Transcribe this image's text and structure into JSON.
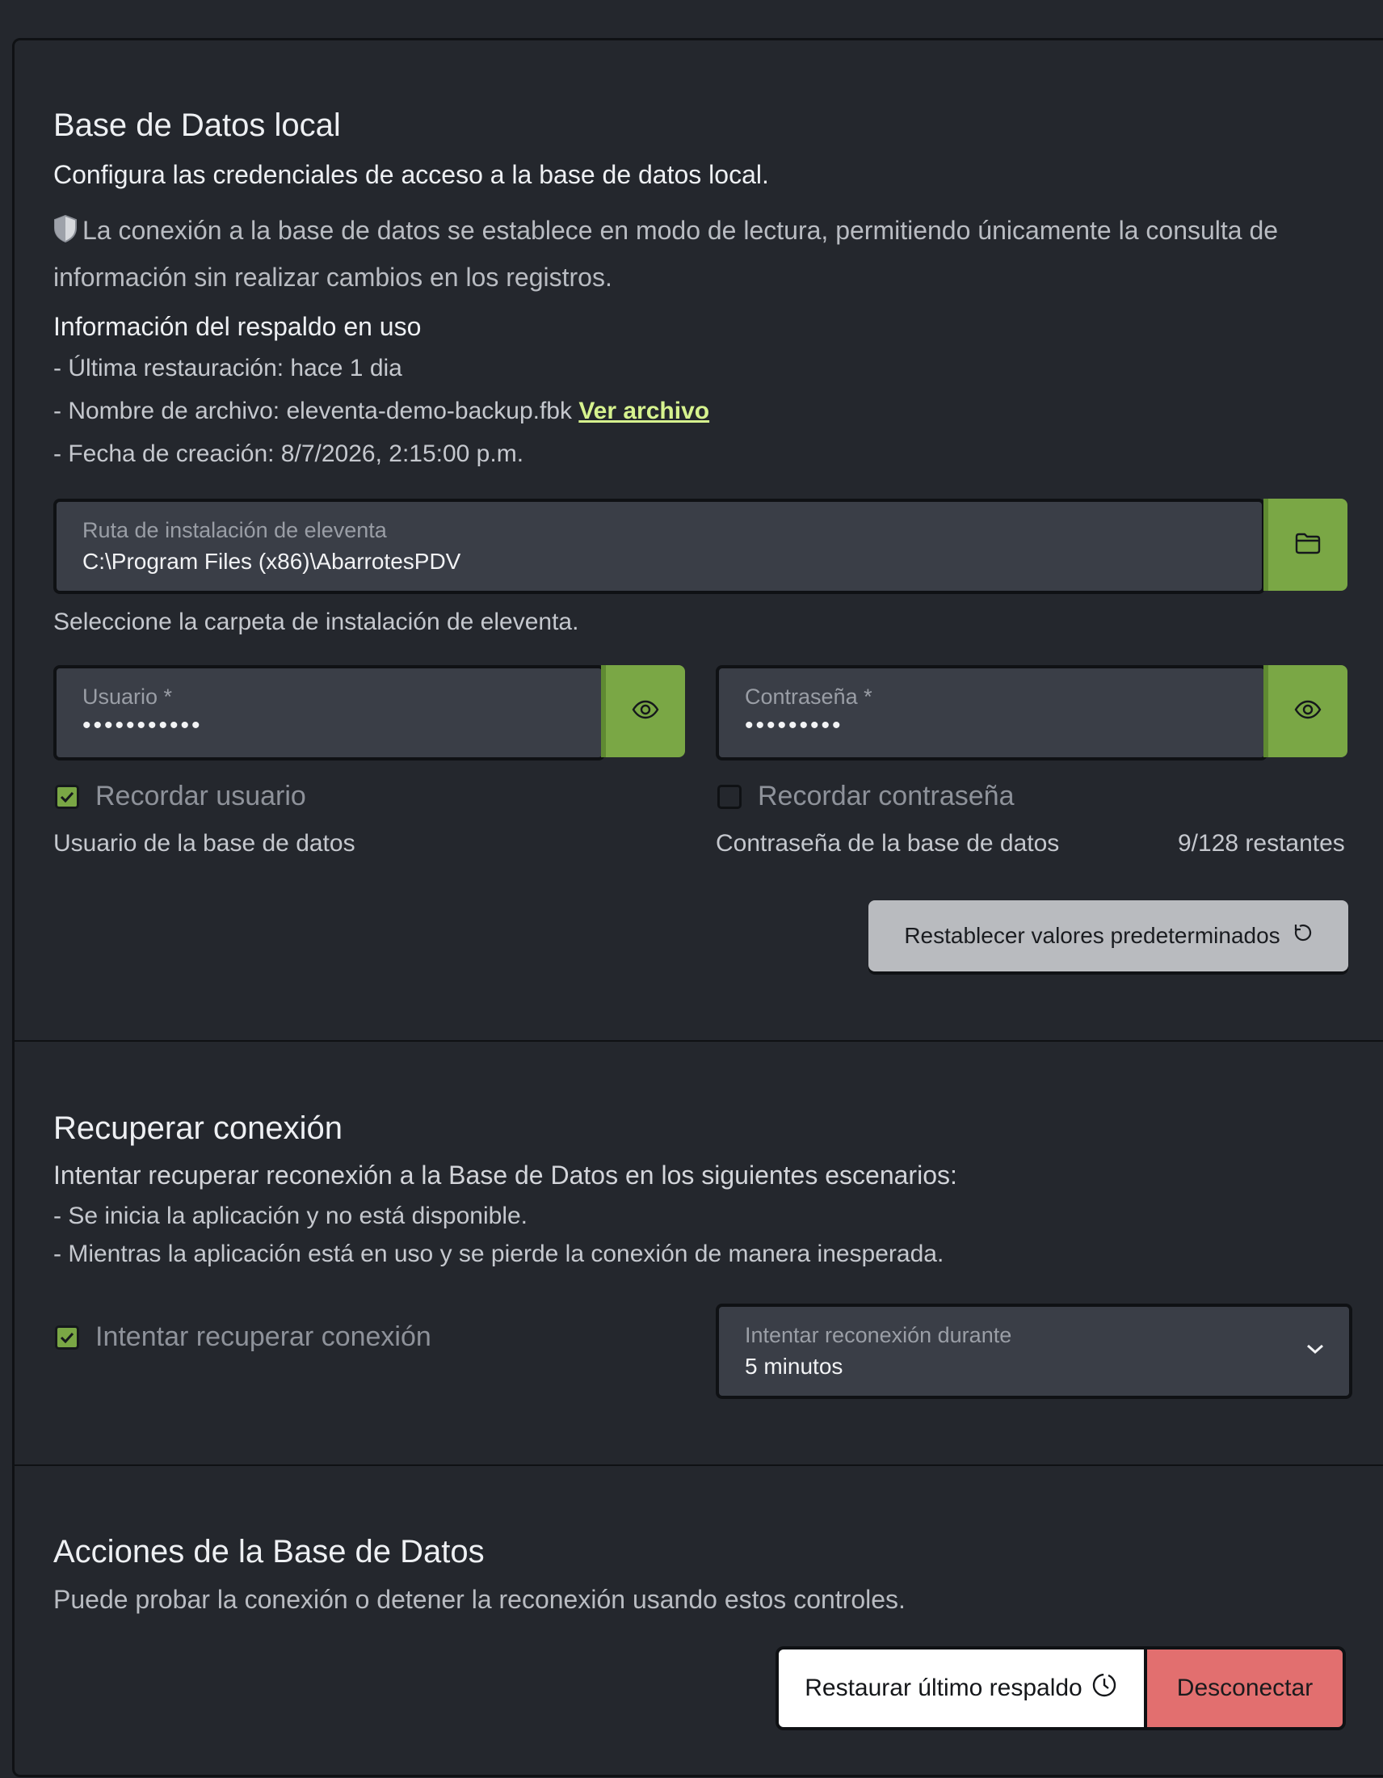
{
  "local_db": {
    "title": "Base de Datos local",
    "subtitle": "Configura las credenciales de acceso a la base de datos local.",
    "read_only_notice": "La conexión a la base de datos se establece en modo de lectura, permitiendo únicamente la consulta de información sin realizar cambios en los registros.",
    "backup_info": {
      "title": "Información del respaldo en uso",
      "last_restore": "- Última restauración: hace 1 dia",
      "file_name_prefix": "- Nombre de archivo: eleventa-demo-backup.fbk",
      "view_file_link": "Ver archivo",
      "created_at": "- Fecha de creación: 8/7/2026, 2:15:00 p.m."
    },
    "install_path": {
      "label": "Ruta de instalación de eleventa",
      "value": "C:\\Program Files (x86)\\AbarrotesPDV",
      "helper": "Seleccione la carpeta de instalación de eleventa.",
      "button_icon": "folder-icon"
    },
    "user": {
      "label": "Usuario *",
      "masked_value": "•••••••••••",
      "remember_label": "Recordar usuario",
      "remember_checked": true,
      "helper": "Usuario de la base de datos"
    },
    "password": {
      "label": "Contraseña *",
      "masked_value": "•••••••••",
      "remember_label": "Recordar contraseña",
      "remember_checked": false,
      "helper": "Contraseña de la base de datos",
      "counter": "9/128 restantes"
    },
    "reset_button": "Restablecer valores predeterminados"
  },
  "reconnect": {
    "title": "Recuperar conexión",
    "subtitle": "Intentar recuperar reconexión a la Base de Datos en los siguientes escenarios:",
    "scenario_1": "- Se inicia la aplicación y no está disponible.",
    "scenario_2": "- Mientras la aplicación está en uso y se pierde la conexión de manera inesperada.",
    "checkbox_label": "Intentar recuperar conexión",
    "checkbox_checked": true,
    "duration_label": "Intentar reconexión durante",
    "duration_value": "5 minutos"
  },
  "actions": {
    "title": "Acciones de la Base de Datos",
    "subtitle": "Puede probar la conexión o detener la reconexión usando estos controles.",
    "restore_button": "Restaurar último respaldo",
    "disconnect_button": "Desconectar"
  },
  "colors": {
    "accent_green": "#7aa745",
    "danger_red": "#e26f6f",
    "link_green": "#d6f28e",
    "background": "#24272d"
  }
}
